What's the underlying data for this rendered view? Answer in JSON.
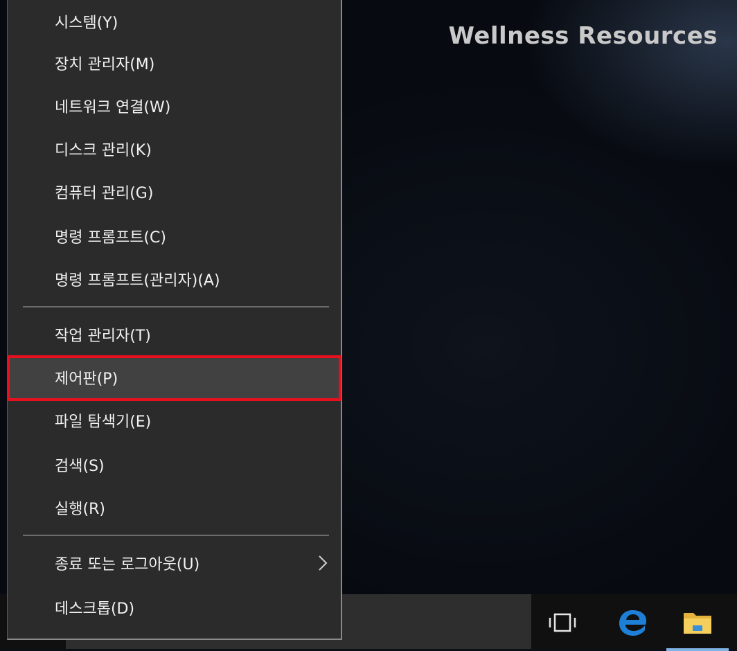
{
  "watermark": "Wellness Resources",
  "menu": {
    "items": [
      {
        "label": "시스템(Y)"
      },
      {
        "label": "장치 관리자(M)"
      },
      {
        "label": "네트워크 연결(W)"
      },
      {
        "label": "디스크 관리(K)"
      },
      {
        "label": "컴퓨터 관리(G)"
      },
      {
        "label": "명령 프롬프트(C)"
      },
      {
        "label": "명령 프롬프트(관리자)(A)"
      },
      {
        "label": "작업 관리자(T)"
      },
      {
        "label": "제어판(P)"
      },
      {
        "label": "파일 탐색기(E)"
      },
      {
        "label": "검색(S)"
      },
      {
        "label": "실행(R)"
      },
      {
        "label": "종료 또는 로그아웃(U)"
      },
      {
        "label": "데스크톱(D)"
      }
    ],
    "highlighted_item": "제어판(P)",
    "highlight_color": "#e8101e"
  },
  "taskbar": {
    "icons": [
      "task-view-icon",
      "edge-browser-icon",
      "file-explorer-icon"
    ],
    "accent_color": "#1e7fd6"
  }
}
